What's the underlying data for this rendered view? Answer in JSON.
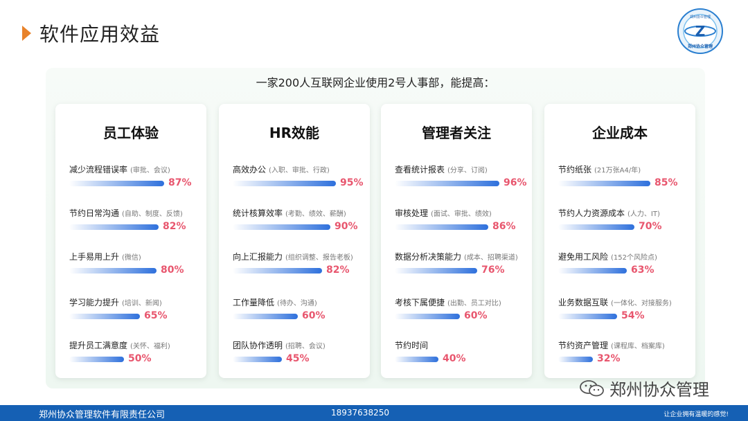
{
  "page": {
    "title": "软件应用效益"
  },
  "subtitle": "一家200人互联网企业使用2号人事部，能提高：",
  "cards": [
    {
      "title": "员工体验",
      "metrics": [
        {
          "label": "减少流程错误率",
          "note": "(审批、会议)",
          "pct": "87%",
          "value": 87
        },
        {
          "label": "节约日常沟通",
          "note": "(自助、制度、反馈)",
          "pct": "82%",
          "value": 82
        },
        {
          "label": "上手易用上升",
          "note": "(微信)",
          "pct": "80%",
          "value": 80
        },
        {
          "label": "学习能力提升",
          "note": "(培训、新闻)",
          "pct": "65%",
          "value": 65
        },
        {
          "label": "提升员工满意度",
          "note": "(关怀、福利)",
          "pct": "50%",
          "value": 50
        }
      ]
    },
    {
      "title": "HR效能",
      "metrics": [
        {
          "label": "高效办公",
          "note": "(入职、审批、行政)",
          "pct": "95%",
          "value": 95
        },
        {
          "label": "统计核算效率",
          "note": "(考勤、绩效、薪酬)",
          "pct": "90%",
          "value": 90
        },
        {
          "label": "向上汇报能力",
          "note": "(组织调整、报告老板)",
          "pct": "82%",
          "value": 82
        },
        {
          "label": "工作量降低",
          "note": "(待办、沟通)",
          "pct": "60%",
          "value": 60
        },
        {
          "label": "团队协作透明",
          "note": "(招聘、会议)",
          "pct": "45%",
          "value": 45
        }
      ]
    },
    {
      "title": "管理者关注",
      "metrics": [
        {
          "label": "查看统计报表",
          "note": "(分享、订阅)",
          "pct": "96%",
          "value": 96
        },
        {
          "label": "审核处理",
          "note": "(面试、审批、绩效)",
          "pct": "86%",
          "value": 86
        },
        {
          "label": "数据分析决策能力",
          "note": "(成本、招聘渠道)",
          "pct": "76%",
          "value": 76
        },
        {
          "label": "考核下属便捷",
          "note": "(出勤、员工对比)",
          "pct": "60%",
          "value": 60
        },
        {
          "label": "节约时间",
          "note": "",
          "pct": "40%",
          "value": 40
        }
      ]
    },
    {
      "title": "企业成本",
      "metrics": [
        {
          "label": "节约纸张",
          "note": "(21万张A4/年)",
          "pct": "85%",
          "value": 85
        },
        {
          "label": "节约人力资源成本",
          "note": "(人力、IT)",
          "pct": "70%",
          "value": 70
        },
        {
          "label": "避免用工风险",
          "note": "(152个风险点)",
          "pct": "63%",
          "value": 63
        },
        {
          "label": "业务数据互联",
          "note": "(一体化、对接服务)",
          "pct": "54%",
          "value": 54
        },
        {
          "label": "节约资产管理",
          "note": "(课程库、档案库)",
          "pct": "32%",
          "value": 32
        }
      ]
    }
  ],
  "watermark": "郑州协众管理",
  "footer": {
    "company": "郑州协众管理软件有限责任公司",
    "phone": "18937638250",
    "slogan": "让企业拥有温暖的感觉!"
  },
  "logo": {
    "top_text": "郑州协众管理",
    "bottom_text": "郑州协众管理",
    "letter": "Z"
  },
  "colors": {
    "accent": "#e8822a",
    "bar": "#2e70dc",
    "percent": "#e8566e",
    "footer": "#1560b4"
  }
}
